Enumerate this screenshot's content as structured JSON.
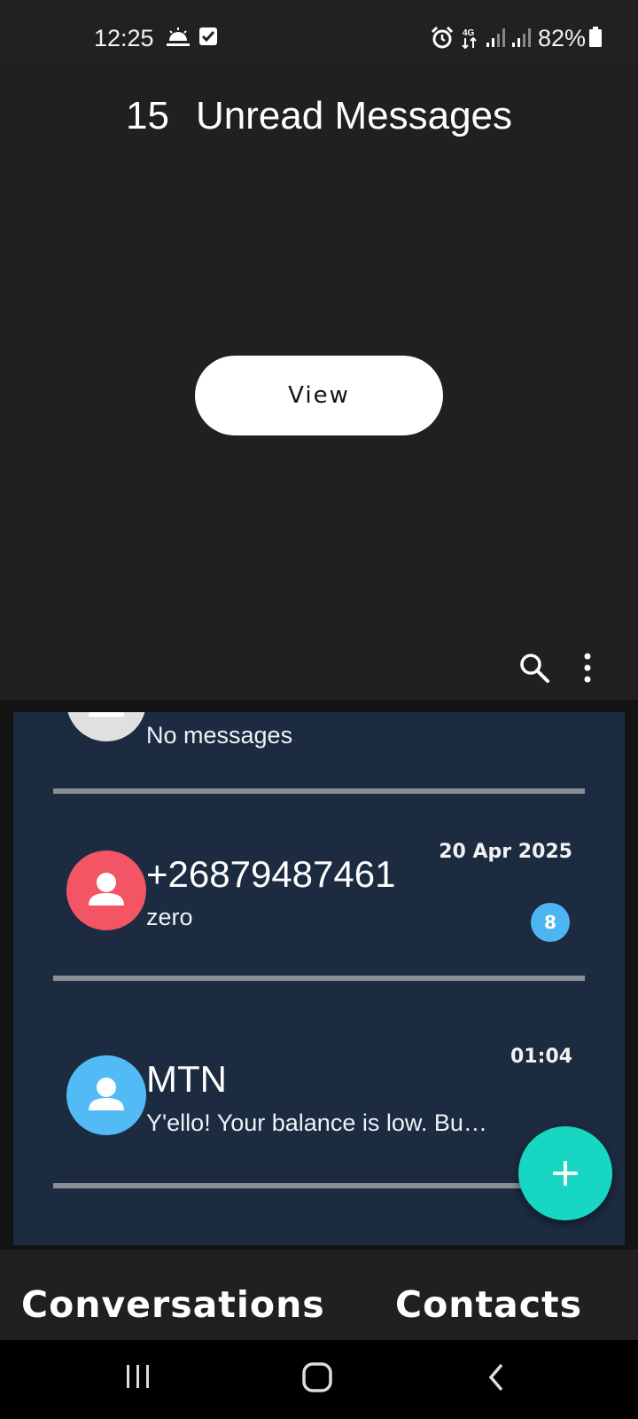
{
  "status_bar": {
    "time": "12:25",
    "battery": "82%",
    "icons": [
      "weather-sunrise-icon",
      "checkbox-icon",
      "alarm-icon",
      "4g-data-icon",
      "signal-sim1-icon",
      "signal-sim2-icon",
      "battery-icon"
    ]
  },
  "header": {
    "unread_count": "15",
    "unread_label": "Unread Messages",
    "view_button": "View",
    "icons": [
      "search-icon",
      "more-vert-icon"
    ]
  },
  "conversations": [
    {
      "name": "",
      "snippet": "No messages",
      "date": "",
      "unread": "",
      "avatar_color": "#e0e0e0"
    },
    {
      "name": "+26879487461",
      "snippet": "zero",
      "date": "20 Apr 2025",
      "unread": "8",
      "avatar_color": "#f25563"
    },
    {
      "name": "MTN",
      "snippet": "Y'ello! Your balance is low. Buy airtime now",
      "date": "01:04",
      "unread": "",
      "avatar_color": "#52baf5"
    }
  ],
  "fab": {
    "icon": "plus-icon"
  },
  "tabs": [
    "Conversations",
    "Contacts"
  ],
  "nav_bar": {
    "icons": [
      "recent-apps-icon",
      "home-icon",
      "back-icon"
    ]
  },
  "colors": {
    "background": "#202020",
    "list_background": "#1c2b40",
    "fab": "#17d6c2",
    "badge": "#4db6f2"
  }
}
